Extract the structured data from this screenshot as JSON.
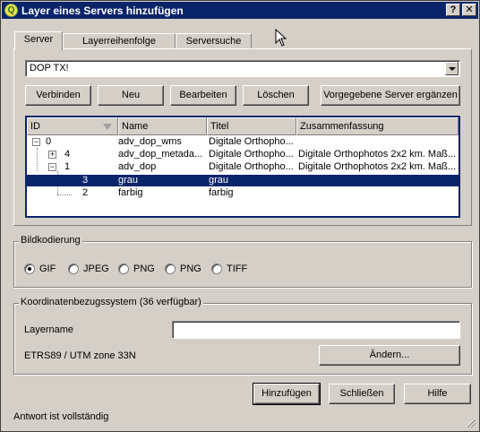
{
  "window": {
    "title": "Layer eines Servers hinzufügen",
    "help_btn": "?",
    "close_btn": "✕",
    "logo_letter": "Q"
  },
  "tabs": [
    "Server",
    "Layerreihenfolge",
    "Serversuche"
  ],
  "server_combo": {
    "value": "DOP TX!"
  },
  "server_buttons": {
    "connect": "Verbinden",
    "new": "Neu",
    "edit": "Bearbeiten",
    "delete": "Löschen",
    "add_default": "Vorgegebene Server ergänzen"
  },
  "layer_tree": {
    "columns": [
      "ID",
      "Name",
      "Titel",
      "Zusammenfassung"
    ],
    "rows": [
      {
        "id": "0",
        "name": "adv_dop_wms",
        "title": "Digitale Orthopho...",
        "summary": "",
        "expander": "−"
      },
      {
        "id": "4",
        "name": "adv_dop_metada...",
        "title": "Digitale Orthopho...",
        "summary": "Digitale Orthophotos 2x2 km. Maß...",
        "expander": "+"
      },
      {
        "id": "1",
        "name": "adv_dop",
        "title": "Digitale Orthopho...",
        "summary": "Digitale Orthophotos 2x2 km. Maß...",
        "expander": "−"
      },
      {
        "id": "3",
        "name": "grau",
        "title": "grau",
        "summary": "",
        "selected": true
      },
      {
        "id": "2",
        "name": "farbig",
        "title": "farbig",
        "summary": ""
      }
    ]
  },
  "image_encoding": {
    "label": "Bildkodierung",
    "options": [
      "GIF",
      "JPEG",
      "PNG",
      "PNG",
      "TIFF"
    ],
    "selected_index": 0
  },
  "crs": {
    "label": "Koordinatenbezugssystem (36 verfügbar)",
    "layername_label": "Layername",
    "layername_value": "",
    "crs_name": "ETRS89 / UTM zone 33N",
    "change_button": "Ändern..."
  },
  "footer_buttons": {
    "add": "Hinzufügen",
    "close": "Schließen",
    "help": "Hilfe"
  },
  "status": "Antwort ist vollständig",
  "colors": {
    "selection": "#0a246a",
    "face": "#d4d0c8",
    "titlebar": "#0a246a"
  }
}
